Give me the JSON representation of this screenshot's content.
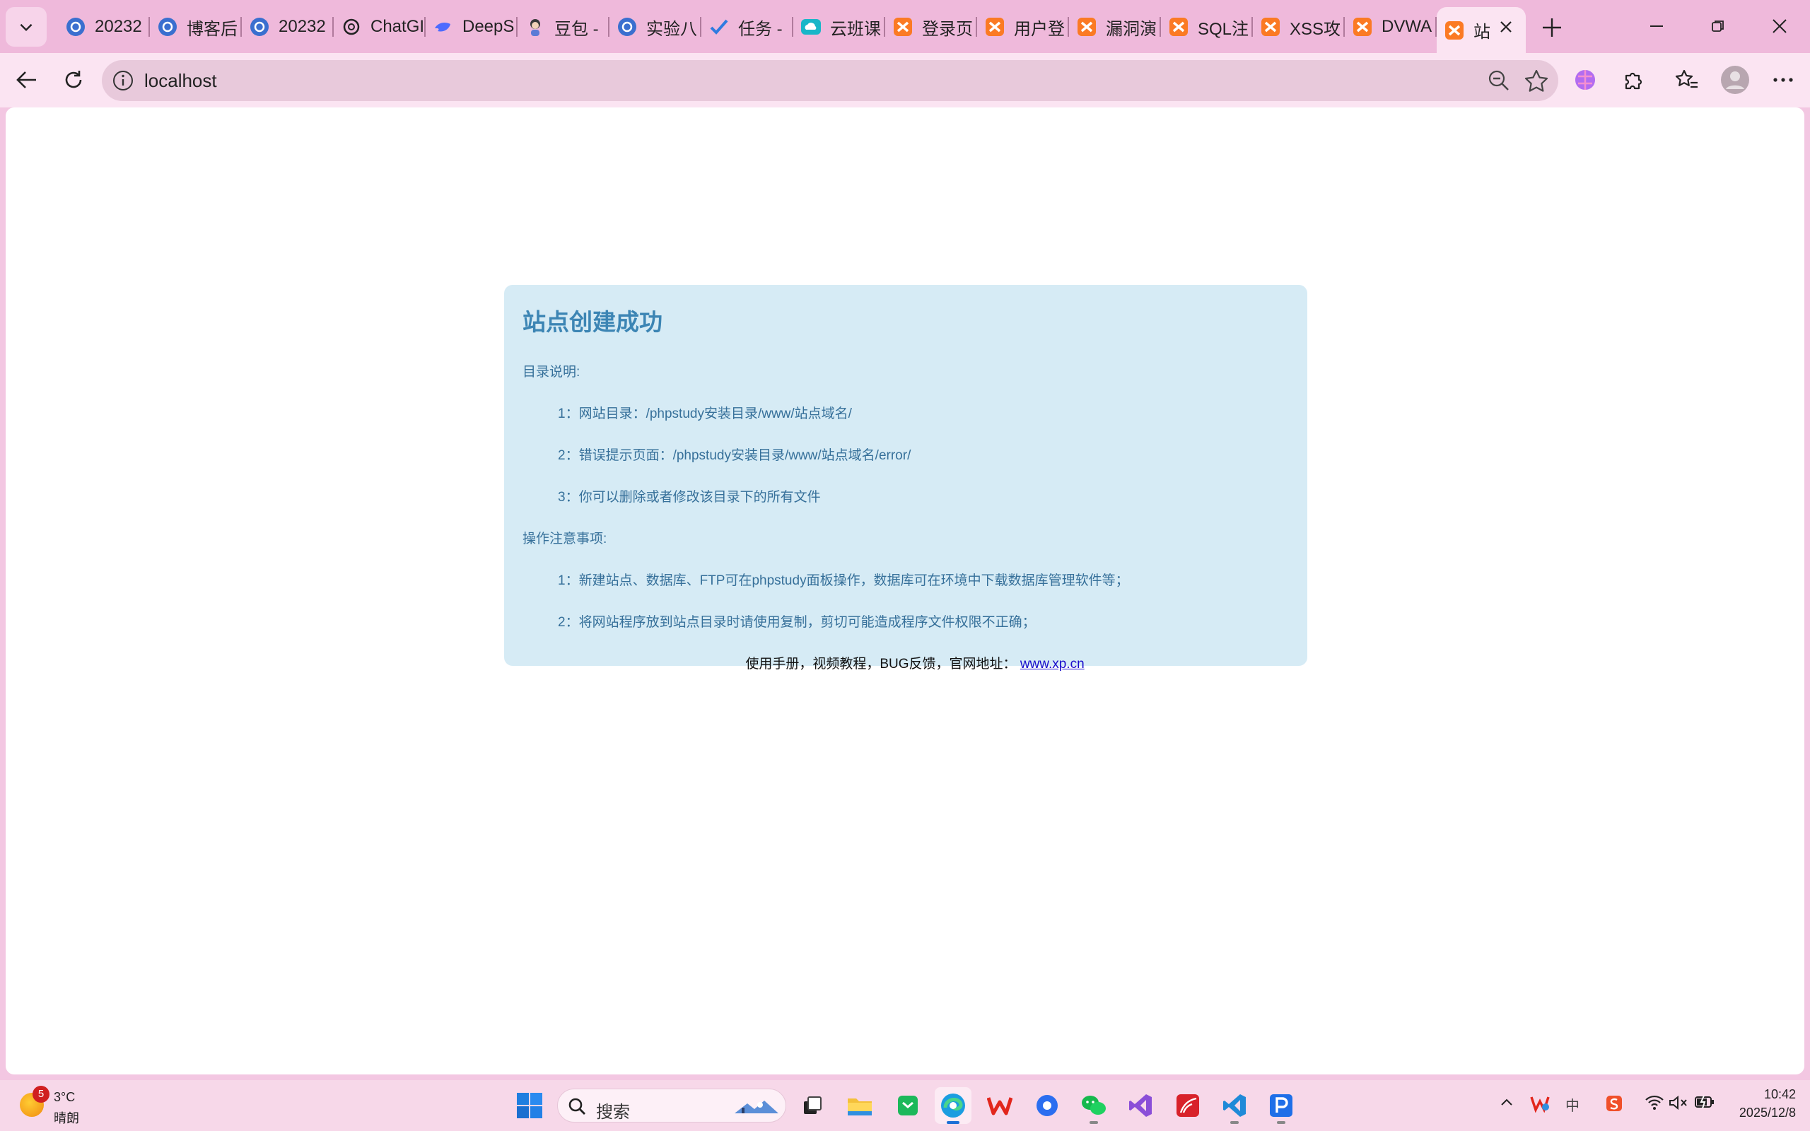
{
  "browser": {
    "tabs": [
      {
        "title": "20232"
      },
      {
        "title": "博客后"
      },
      {
        "title": "20232"
      },
      {
        "title": "ChatGI"
      },
      {
        "title": "DeepS"
      },
      {
        "title": "豆包 -"
      },
      {
        "title": "实验八"
      },
      {
        "title": "任务 -"
      },
      {
        "title": "云班课"
      },
      {
        "title": "登录页"
      },
      {
        "title": "用户登"
      },
      {
        "title": "漏洞演"
      },
      {
        "title": "SQL注"
      },
      {
        "title": "XSS攻"
      },
      {
        "title": "DVWA"
      },
      {
        "title": "站"
      }
    ],
    "address": "localhost"
  },
  "page": {
    "title": "站点创建成功",
    "dir_heading": "目录说明:",
    "dir_items": [
      "1：网站目录：/phpstudy安装目录/www/站点域名/",
      "2：错误提示页面：/phpstudy安装目录/www/站点域名/error/",
      "3：你可以删除或者修改该目录下的所有文件"
    ],
    "ops_heading": "操作注意事项:",
    "ops_items": [
      "1：新建站点、数据库、FTP可在phpstudy面板操作，数据库可在环境中下载数据库管理软件等；",
      "2：将网站程序放到站点目录时请使用复制，剪切可能造成程序文件权限不正确；"
    ],
    "footer_text": "使用手册，视频教程，BUG反馈，官网地址：",
    "footer_link": "www.xp.cn"
  },
  "taskbar": {
    "weather_badge": "5",
    "weather_temp": "3°C",
    "weather_cond": "晴朗",
    "search_label": "搜索",
    "time": "10:42",
    "date": "2025/12/8",
    "ime": "中"
  },
  "colors": {
    "tabstrip": "#efb9db",
    "toolbar": "#fbe4f2",
    "card_bg": "#d6ebf5",
    "card_title": "#3c85b4",
    "card_text": "#36709a",
    "link": "#1a0dcc"
  }
}
